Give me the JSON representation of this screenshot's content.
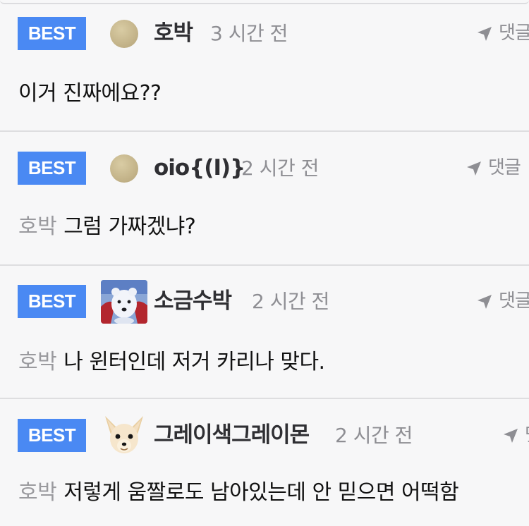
{
  "comments": [
    {
      "badge": "BEST",
      "nickname": "호박",
      "time": "3 시간 전",
      "reply_label": "댓글",
      "avatar": "beige-dot-avatar",
      "mention": "",
      "text": "이거 진짜에요??"
    },
    {
      "badge": "BEST",
      "nickname": "oio{(I)}",
      "time": "2 시간 전",
      "reply_label": "댓글",
      "avatar": "beige-dot-avatar",
      "mention": "호박",
      "text": "그럼 가짜겠냐?"
    },
    {
      "badge": "BEST",
      "nickname": "소금수박",
      "time": "2 시간 전",
      "reply_label": "댓글",
      "avatar": "polar-bear-avatar",
      "mention": "호박",
      "text": "나 윈터인데 저거 카리나 맞다."
    },
    {
      "badge": "BEST",
      "nickname": "그레이색그레이몬",
      "time": "2 시간 전",
      "reply_label": "댓",
      "avatar": "chihuahua-avatar",
      "mention": "호박",
      "text": "저렇게 움짤로도 남아있는데 안 믿으면 어떡함"
    }
  ],
  "colors": {
    "badge": "#4a89f3",
    "background": "#f7f7f8",
    "muted_text": "#8e8e93"
  }
}
